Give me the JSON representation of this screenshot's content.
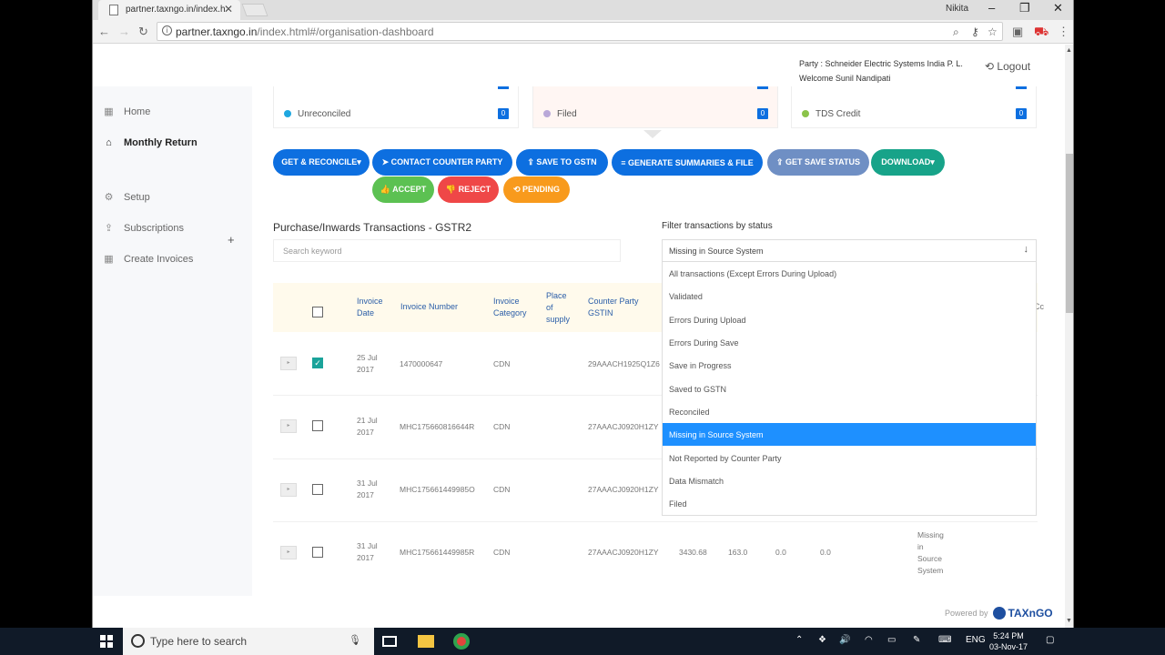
{
  "browser": {
    "tab_title": "partner.taxngo.in/index.h",
    "user_name": "Nikita",
    "url_domain": "partner.taxngo.in",
    "url_path": "/index.html#/organisation-dashboard"
  },
  "header": {
    "party": "Party : Schneider Electric Systems India P. L.",
    "welcome": "Welcome Sunil Nandipati",
    "logout": "Logout"
  },
  "sidebar": {
    "items": [
      {
        "label": "Home",
        "icon": "grid-icon"
      },
      {
        "label": "Monthly Return",
        "icon": "home-icon"
      },
      {
        "label": "Setup",
        "icon": "gear-icon"
      },
      {
        "label": "Subscriptions",
        "icon": "upload-icon"
      },
      {
        "label": "Create Invoices",
        "icon": "grid-icon"
      }
    ],
    "plus": "+"
  },
  "cards": [
    {
      "label": "Unreconciled",
      "count": "0",
      "dot_color": "#1ea7e0"
    },
    {
      "label": "Filed",
      "count": "0",
      "dot_color": "#b9a8d8"
    },
    {
      "label": "TDS Credit",
      "count": "0",
      "dot_color": "#8bc34a"
    }
  ],
  "buttons": {
    "get_reconcile": "GET & RECONCILE▾",
    "contact": "➤ CONTACT COUNTER PARTY",
    "save_gstn": "⇪ SAVE TO GSTN",
    "generate": "≡ GENERATE SUMMARIES & FILE",
    "get_save_status": "⇪ GET SAVE STATUS",
    "download": "DOWNLOAD▾",
    "accept": "👍 ACCEPT",
    "reject": "👎 REJECT",
    "pending": "⟲ PENDING"
  },
  "section": {
    "title": "Purchase/Inwards Transactions - GSTR2",
    "search_placeholder": "Search keyword",
    "filter_label": "Filter transactions by status",
    "filter_value": "Missing in Source System"
  },
  "table": {
    "headers": {
      "invoice_date": "Invoice Date",
      "invoice_number": "Invoice Number",
      "invoice_category": "Invoice Category",
      "place_of_supply": "Place of supply",
      "counter_party": "Counter Party GSTIN",
      "partial_col": "Cc"
    },
    "rows": [
      {
        "date_line1": "25 Jul",
        "date_line2": "2017",
        "number": "1470000647",
        "category": "CDN",
        "gstin": "29AAACH1925Q1Z6",
        "checked": true
      },
      {
        "date_line1": "21 Jul",
        "date_line2": "2017",
        "number": "MHC175660816644R",
        "category": "CDN",
        "gstin": "27AAACJ0920H1ZY",
        "checked": false
      },
      {
        "date_line1": "31 Jul",
        "date_line2": "2017",
        "number": "MHC175661449985O",
        "category": "CDN",
        "gstin": "27AAACJ0920H1ZY",
        "checked": false
      },
      {
        "date_line1": "31 Jul",
        "date_line2": "2017",
        "number": "MHC175661449985R",
        "category": "CDN",
        "gstin": "27AAACJ0920H1ZY",
        "checked": false,
        "v1": "3430.68",
        "v2": "163.0",
        "v3": "0.0",
        "v4": "0.0",
        "status_l1": "Missing",
        "status_l2": "in",
        "status_l3": "Source",
        "status_l4": "System"
      }
    ]
  },
  "dropdown": {
    "options": [
      "All transactions (Except Errors During Upload)",
      "Validated",
      "Errors During Upload",
      "Errors During Save",
      "Save in Progress",
      "Saved to GSTN",
      "Reconciled",
      "Missing in Source System",
      "Not Reported by Counter Party",
      "Data Mismatch",
      "Filed"
    ],
    "selected_index": 7
  },
  "footer": {
    "powered_by": "Powered by",
    "logo_text": "TAXnGO"
  },
  "taskbar": {
    "search_placeholder": "Type here to search",
    "lang": "ENG",
    "time": "5:24 PM",
    "date": "03-Nov-17"
  }
}
